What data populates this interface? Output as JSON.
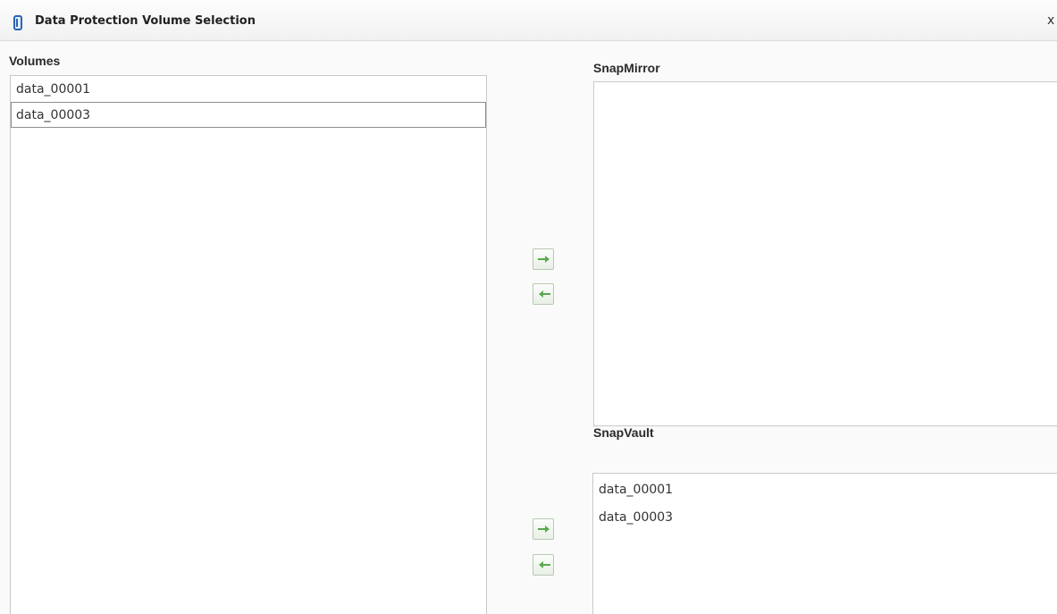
{
  "dialog": {
    "title": "Data Protection Volume Selection",
    "close_label": "x"
  },
  "volumes": {
    "label": "Volumes",
    "items": [
      "data_00001",
      "data_00003"
    ],
    "selected": "data_00003"
  },
  "snapmirror": {
    "label": "SnapMirror",
    "items": []
  },
  "snapvault": {
    "label": "SnapVault",
    "items": [
      "data_00001",
      "data_00003"
    ]
  },
  "icons": {
    "add": "arrow-right-icon",
    "remove": "arrow-left-icon",
    "accent": "#5aa84f"
  }
}
